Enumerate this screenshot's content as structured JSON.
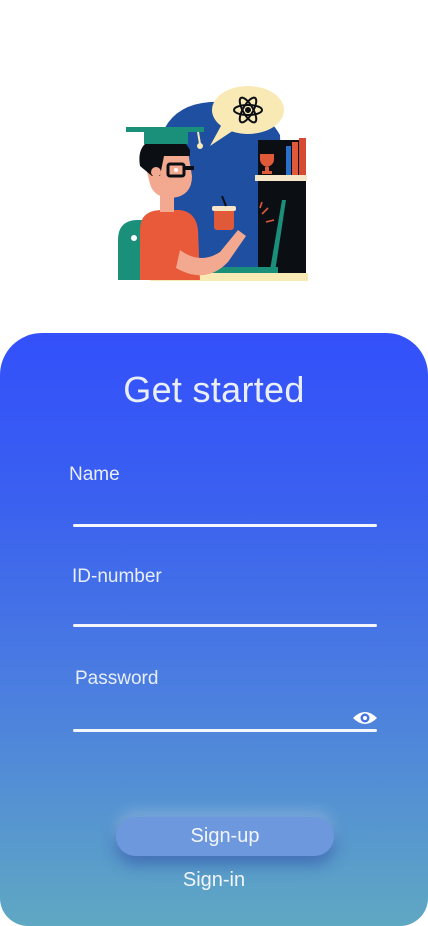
{
  "title": "Get started",
  "form": {
    "name_label": "Name",
    "id_label": "ID-number",
    "password_label": "Password",
    "name_value": "",
    "id_value": "",
    "password_value": ""
  },
  "actions": {
    "signup_label": "Sign-up",
    "signin_label": "Sign-in"
  },
  "icons": {
    "password_toggle": "eye-icon",
    "illustration": "student-graduate-illustration",
    "atom": "atom-icon"
  },
  "colors": {
    "panel_top": "#3350fb",
    "panel_bottom": "#5fa8c3",
    "button": "#6d98dd",
    "text": "#e9eef9"
  }
}
